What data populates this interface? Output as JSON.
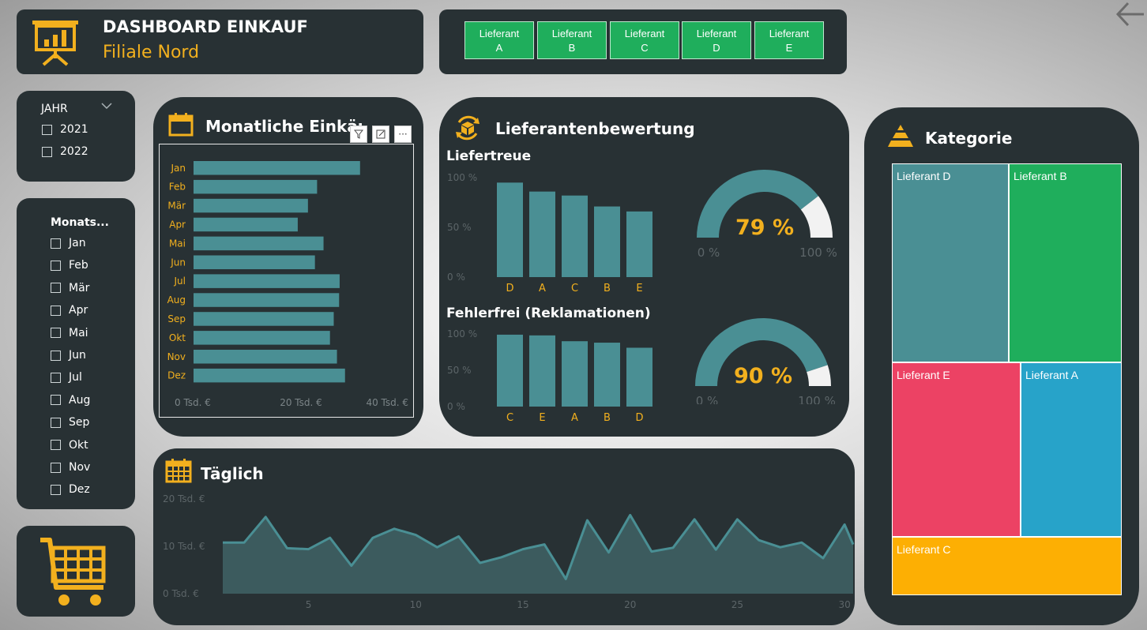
{
  "header": {
    "title": "DASHBOARD EINKAUF",
    "subtitle": "Filiale Nord",
    "icon": "presentation-chart-icon"
  },
  "suppliers": [
    {
      "line1": "Lieferant",
      "line2": "A"
    },
    {
      "line1": "Lieferant",
      "line2": "B"
    },
    {
      "line1": "Lieferant",
      "line2": "C"
    },
    {
      "line1": "Lieferant",
      "line2": "D"
    },
    {
      "line1": "Lieferant",
      "line2": "E"
    }
  ],
  "year_slicer": {
    "title": "JAHR",
    "options": [
      "2021",
      "2022"
    ]
  },
  "month_slicer": {
    "title": "Monats...",
    "options": [
      "Jan",
      "Feb",
      "Mär",
      "Apr",
      "Mai",
      "Jun",
      "Jul",
      "Aug",
      "Sep",
      "Okt",
      "Nov",
      "Dez"
    ]
  },
  "monthly": {
    "title": "Monatliche Einkäufe",
    "tool_more": "···"
  },
  "rating": {
    "title": "Lieferantenbewertung",
    "sub1": "Liefertreue",
    "sub2": "Fehlerfrei (Reklamationen)"
  },
  "daily": {
    "title": "Täglich"
  },
  "category": {
    "title": "Kategorie"
  },
  "colors": {
    "panel": "#283134",
    "teal": "#4a8f94",
    "gold": "#f2b01e",
    "green": "#1fae5c",
    "pink": "#ec4264",
    "blue": "#27a3c9",
    "amber": "#fdaf03"
  },
  "chart_data": [
    {
      "type": "bar",
      "orientation": "horizontal",
      "categories": [
        "Jan",
        "Feb",
        "Mär",
        "Apr",
        "Mai",
        "Jun",
        "Jul",
        "Aug",
        "Sep",
        "Okt",
        "Nov",
        "Dez"
      ],
      "values": [
        31,
        23,
        21.3,
        19.4,
        24.2,
        22.6,
        27.2,
        27.1,
        26.1,
        25.4,
        26.7,
        28.2
      ],
      "xlim": [
        0,
        40
      ],
      "xticks": [
        "0 Tsd. €",
        "20 Tsd. €",
        "40 Tsd. €"
      ]
    },
    {
      "type": "bar",
      "title": "Liefertreue",
      "categories": [
        "D",
        "A",
        "C",
        "B",
        "E"
      ],
      "values": [
        95,
        86,
        82,
        71,
        66
      ],
      "ylim": [
        0,
        100
      ],
      "yticks": [
        "100 %",
        "50 %",
        "0 %"
      ]
    },
    {
      "type": "bar",
      "title": "Fehlerfrei (Reklamationen)",
      "categories": [
        "C",
        "E",
        "A",
        "B",
        "D"
      ],
      "values": [
        99,
        98,
        90,
        88,
        81
      ],
      "ylim": [
        0,
        100
      ],
      "yticks": [
        "100 %",
        "50 %",
        "0 %"
      ]
    },
    {
      "type": "gauge",
      "value": 79,
      "label": "79 %",
      "min_label": "0 %",
      "max_label": "100 %",
      "range": [
        0,
        100
      ]
    },
    {
      "type": "gauge",
      "value": 90,
      "label": "90 %",
      "min_label": "0 %",
      "max_label": "100 %",
      "range": [
        0,
        100
      ]
    },
    {
      "type": "area",
      "title": "Täglich",
      "x": [
        1,
        2,
        3,
        4,
        5,
        6,
        7,
        8,
        9,
        10,
        11,
        12,
        13,
        14,
        15,
        16,
        17,
        18,
        19,
        20,
        21,
        22,
        23,
        24,
        25,
        26,
        27,
        28,
        29,
        30,
        30.4
      ],
      "values": [
        10.8,
        10.8,
        16.2,
        9.6,
        9.4,
        11.8,
        5.9,
        11.8,
        13.7,
        12.4,
        9.8,
        12.1,
        6.5,
        7.7,
        9.4,
        10.4,
        3.1,
        15.5,
        8.7,
        16.6,
        8.9,
        9.7,
        15.7,
        9.3,
        15.7,
        11.3,
        9.8,
        10.8,
        7.5,
        14.6,
        10.4
      ],
      "ylim": [
        0,
        20
      ],
      "yticks": [
        "20 Tsd. €",
        "10 Tsd. €",
        "0 Tsd. €"
      ],
      "xticks": [
        5,
        10,
        15,
        20,
        25,
        30
      ]
    },
    {
      "type": "treemap",
      "title": "Kategorie",
      "items": [
        {
          "name": "Lieferant D",
          "color": "#4a8f94"
        },
        {
          "name": "Lieferant B",
          "color": "#1fae5c"
        },
        {
          "name": "Lieferant E",
          "color": "#ec4264"
        },
        {
          "name": "Lieferant A",
          "color": "#27a3c9"
        },
        {
          "name": "Lieferant C",
          "color": "#fdaf03"
        }
      ]
    }
  ]
}
